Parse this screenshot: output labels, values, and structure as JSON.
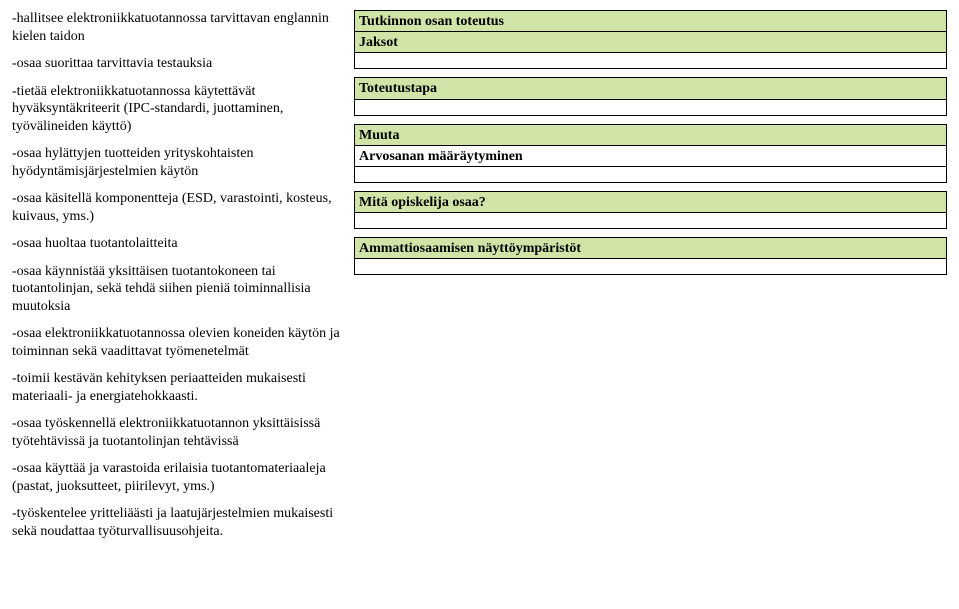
{
  "left": {
    "items": [
      "-hallitsee elektroniikkatuotannossa tarvittavan englannin kielen taidon",
      "-osaa suorittaa tarvittavia testauksia",
      "-tietää elektroniikkatuotannossa käytettävät hyväksyntäkriteerit (IPC-standardi, juottaminen, työvälineiden käyttö)",
      "-osaa hylättyjen tuotteiden yrityskohtaisten hyödyntämisjärjestelmien käytön",
      "-osaa käsitellä komponentteja (ESD, varastointi, kosteus, kuivaus, yms.)",
      "-osaa huoltaa tuotantolaitteita",
      "-osaa käynnistää yksittäisen tuotantokoneen tai tuotantolinjan, sekä tehdä siihen pieniä toiminnallisia muutoksia",
      "-osaa elektroniikkatuotannossa olevien koneiden käytön ja toiminnan sekä vaadittavat työmenetelmät",
      "-toimii kestävän kehityksen periaatteiden mukaisesti materiaali- ja energiatehokkaasti.",
      "-osaa työskennellä elektroniikkatuotannon yksittäisissä työtehtävissä ja tuotantolinjan tehtävissä",
      "-osaa käyttää ja varastoida erilaisia tuotantomateriaaleja (pastat, juoksutteet, piirilevyt, yms.)",
      "-työskentelee yritteliäästi ja laatujärjestelmien mukaisesti sekä noudattaa työturvallisuusohjeita."
    ]
  },
  "right": {
    "h1": "Tutkinnon osan toteutus",
    "h2": "Jaksot",
    "h3": "Toteutustapa",
    "h4": "Muuta",
    "h5": "Arvosanan määräytyminen",
    "h6": "Mitä opiskelija osaa?",
    "h7": "Ammattiosaamisen näyttöympäristöt"
  }
}
